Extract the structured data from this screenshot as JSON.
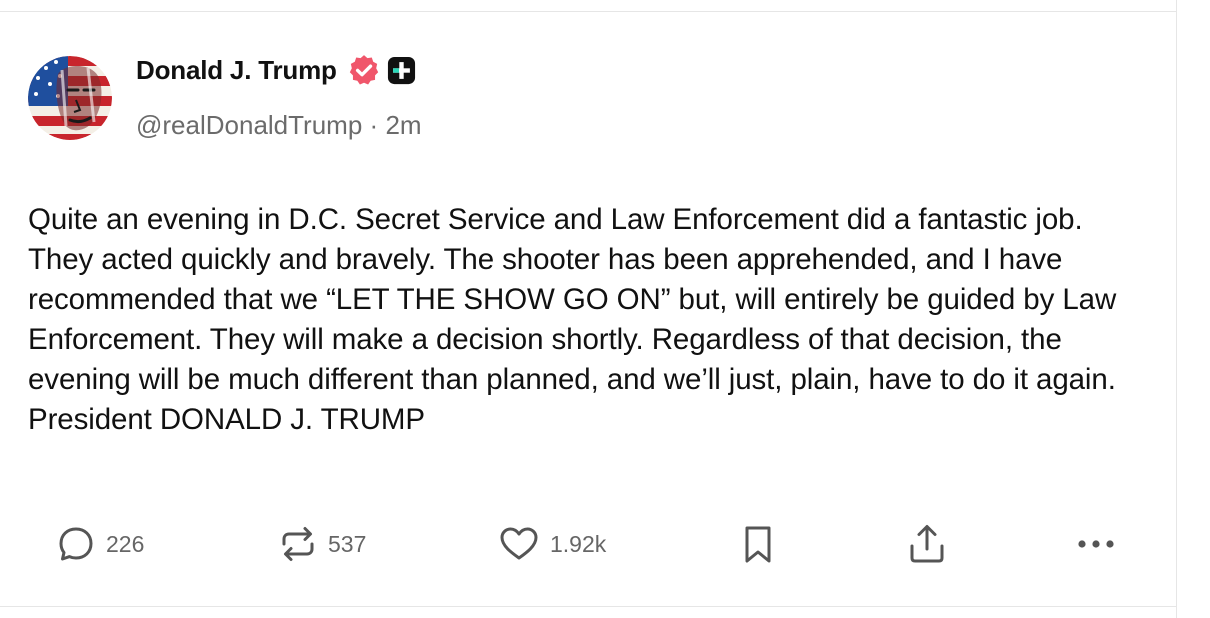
{
  "post": {
    "display_name": "Donald J. Trump",
    "handle": "@realDonaldTrump",
    "separator": "·",
    "time_ago": "2m",
    "body": "Quite an evening in D.C. Secret Service and Law Enforcement did a fantastic job. They acted quickly and bravely. The shooter has been apprehended, and I have recommended that we “LET THE SHOW GO ON” but, will entirely be guided by Law Enforcement. They will make a decision shortly. Regardless of that decision, the evening will be much different than planned, and we’ll just, plain, have to do it again. President DONALD J. TRUMP",
    "verified_icon": "verified-badge-icon",
    "plus_icon": "plus-badge-icon"
  },
  "actions": {
    "reply_count": "226",
    "repost_count": "537",
    "like_count": "1.92k",
    "icons": [
      "reply-icon",
      "repost-icon",
      "like-icon",
      "bookmark-icon",
      "share-icon",
      "more-icon"
    ]
  },
  "colors": {
    "verified_badge": "#f0566b",
    "name_text": "#111111",
    "meta_text": "#6b6b6b",
    "action_text": "#666666",
    "divider": "#e6e6e6"
  }
}
